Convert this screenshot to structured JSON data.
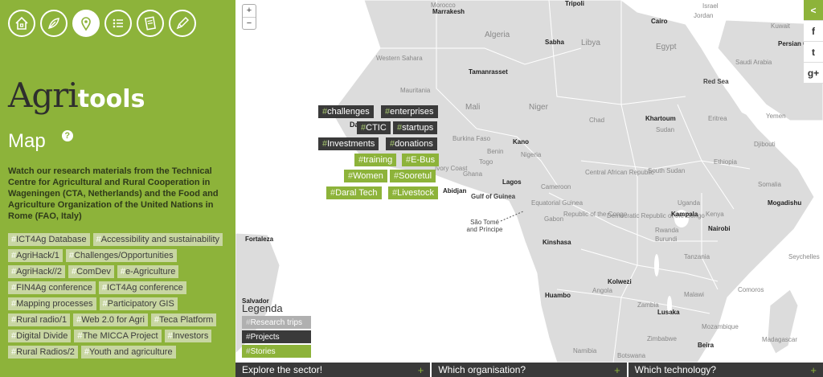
{
  "nav": [
    {
      "name": "home-icon"
    },
    {
      "name": "leaf-icon"
    },
    {
      "name": "map-pin-icon",
      "active": true
    },
    {
      "name": "list-icon"
    },
    {
      "name": "document-icon"
    },
    {
      "name": "pencil-icon"
    }
  ],
  "brand": {
    "part1": "Agri",
    "part2": "tools"
  },
  "page": {
    "title": "Map",
    "help": "?"
  },
  "intro": "Watch our research materials from the Technical Centre for Agricultural and Rural Cooperation in Wageningen (CTA, Netherlands) and the Food and Agriculture Organization of the United Nations in Rome (FAO, Italy)",
  "hash": "#",
  "tags": [
    "ICT4Ag Database",
    "Accessibility and sustainability",
    "AgriHack/1",
    "Challenges/Opportunities",
    "AgriHack//2",
    "ComDev",
    "e-Agriculture",
    "FIN4Ag conference",
    "ICT4Ag conference",
    "Mapping processes",
    "Participatory GIS",
    "Rural radio/1",
    "Web 2.0 for Agri",
    "Teca Platform",
    "Digital Divide",
    "The MICCA Project",
    "Investors",
    "Rural Radios/2",
    "Youth and agriculture"
  ],
  "zoom": {
    "in": "+",
    "out": "−"
  },
  "share": [
    "<",
    "f",
    "t",
    "g+"
  ],
  "map_tags": [
    {
      "label": "challenges",
      "style": "dark"
    },
    {
      "label": "enterprises",
      "style": "dark"
    },
    {
      "label": "CTIC",
      "style": "dark"
    },
    {
      "label": "startups",
      "style": "dark"
    },
    {
      "label": "Investments",
      "style": "dark"
    },
    {
      "label": "donations",
      "style": "dark"
    },
    {
      "label": "training",
      "style": "green"
    },
    {
      "label": "E-Bus",
      "style": "green"
    },
    {
      "label": "Women",
      "style": "green"
    },
    {
      "label": "Sooretul",
      "style": "green"
    },
    {
      "label": "Daral Tech",
      "style": "green"
    },
    {
      "label": "Livestock",
      "style": "green"
    }
  ],
  "countries": [
    "Morocco",
    "Algeria",
    "Libya",
    "Egypt",
    "Jordan",
    "Kuwait",
    "Persian Gulf",
    "Saudi Arabia",
    "Western Sahara",
    "Mauritania",
    "Mali",
    "Niger",
    "Chad",
    "Sudan",
    "Eritrea",
    "Yemen",
    "Burkina Faso",
    "Benin",
    "Togo",
    "Ghana",
    "Ivory Coast",
    "Nigeria",
    "Cameroon",
    "Central African Republic",
    "South Sudan",
    "Ethiopia",
    "Djibouti",
    "Equatorial Guinea",
    "Gabon",
    "Republic of the Congo",
    "Democratic Republic of the Congo",
    "Uganda",
    "Kenya",
    "Rwanda",
    "Burundi",
    "Tanzania",
    "Angola",
    "Zambia",
    "Malawi",
    "Mozambique",
    "Zimbabwe",
    "Namibia",
    "Botswana",
    "Madagascar",
    "Comoros",
    "Seychelles",
    "Somalia",
    "São Tomé and Príncipe",
    "Da",
    "Tripoli",
    "Israel"
  ],
  "cities": [
    "Marrakesh",
    "Sabha",
    "Cairo",
    "Tamanrasset",
    "Red Sea",
    "Khartoum",
    "Kano",
    "Lagos",
    "Abidjan",
    "Gulf of Guinea",
    "Kampala",
    "Nairobi",
    "Mogadishu",
    "Kinshasa",
    "Fortaleza",
    "Kolwezi",
    "Huambo",
    "Lusaka",
    "Salvador",
    "Beira"
  ],
  "legend": {
    "title": "Legenda",
    "research": "Research trips",
    "projects": "Projects",
    "stories": "Stories"
  },
  "bottom": {
    "b1": "Explore the sector!",
    "b2": "Which organisation?",
    "b3": "Which technology?",
    "plus": "+"
  }
}
